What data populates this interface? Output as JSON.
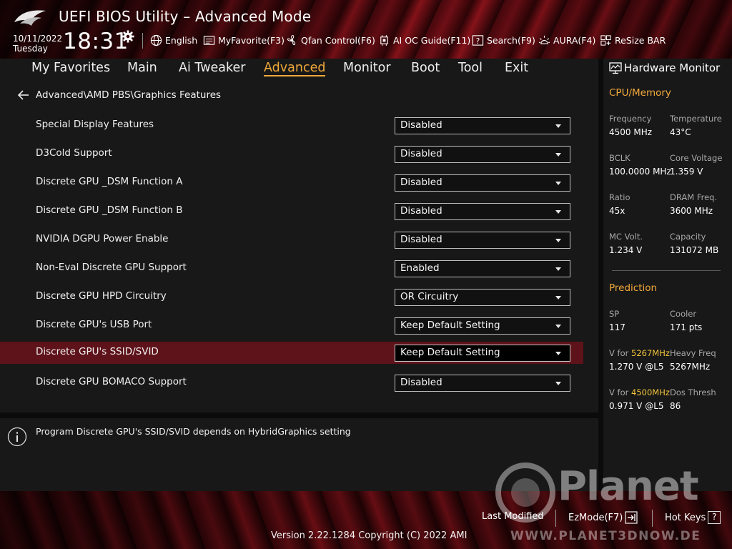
{
  "app": {
    "title": "UEFI BIOS Utility – Advanced Mode"
  },
  "header": {
    "date": "10/11/2022",
    "day": "Tuesday",
    "time": "18:31",
    "tools": {
      "language": "English",
      "myfavorite": "MyFavorite(F3)",
      "qfan": "Qfan Control(F6)",
      "oc_guide": "AI OC Guide(F11)",
      "search": "Search(F9)",
      "aura": "AURA(F4)",
      "resize_bar": "ReSize BAR"
    }
  },
  "tabs": [
    {
      "label": "My Favorites",
      "active": false
    },
    {
      "label": "Main",
      "active": false
    },
    {
      "label": "Ai Tweaker",
      "active": false
    },
    {
      "label": "Advanced",
      "active": true
    },
    {
      "label": "Monitor",
      "active": false
    },
    {
      "label": "Boot",
      "active": false
    },
    {
      "label": "Tool",
      "active": false
    },
    {
      "label": "Exit",
      "active": false
    }
  ],
  "breadcrumb": "Advanced\\AMD PBS\\Graphics Features",
  "settings": [
    {
      "label": "Special Display Features",
      "value": "Disabled"
    },
    {
      "label": "D3Cold Support",
      "value": "Disabled"
    },
    {
      "label": "Discrete GPU _DSM Function A",
      "value": "Disabled"
    },
    {
      "label": "Discrete GPU _DSM Function B",
      "value": "Disabled"
    },
    {
      "label": "NVIDIA DGPU Power Enable",
      "value": "Disabled"
    },
    {
      "label": "Non-Eval Discrete GPU Support",
      "value": "Enabled"
    },
    {
      "label": "Discrete GPU HPD Circuitry",
      "value": "OR Circuitry"
    },
    {
      "label": "Discrete GPU's USB Port",
      "value": "Keep Default Setting"
    },
    {
      "label": "Discrete GPU's SSID/SVID",
      "value": "Keep Default Setting",
      "selected": true
    },
    {
      "label": "Discrete GPU BOMACO Support",
      "value": "Disabled"
    }
  ],
  "help_text": "Program Discrete GPU's SSID/SVID depends on HybridGraphics setting",
  "hardware_monitor": {
    "title": "Hardware Monitor",
    "cpu_memory": {
      "section": "CPU/Memory",
      "frequency_label": "Frequency",
      "frequency_value": "4500 MHz",
      "temperature_label": "Temperature",
      "temperature_value": "43°C",
      "bclk_label": "BCLK",
      "bclk_value": "100.0000 MHz",
      "core_voltage_label": "Core Voltage",
      "core_voltage_value": "1.359 V",
      "ratio_label": "Ratio",
      "ratio_value": "45x",
      "dram_freq_label": "DRAM Freq.",
      "dram_freq_value": "3600 MHz",
      "mc_volt_label": "MC Volt.",
      "mc_volt_value": "1.234 V",
      "capacity_label": "Capacity",
      "capacity_value": "131072 MB"
    },
    "prediction": {
      "section": "Prediction",
      "sp_label": "SP",
      "sp_value": "117",
      "cooler_label": "Cooler",
      "cooler_value": "171 pts",
      "v_for_prefix": "V for ",
      "v_for_1_freq": "5267MHz",
      "v_for_1_value": "1.270 V @L5",
      "heavy_freq_label": "Heavy Freq",
      "heavy_freq_value": "5267MHz",
      "v_for_2_freq": "4500MHz",
      "v_for_2_value": "0.971 V @L5",
      "dos_thresh_label": "Dos Thresh",
      "dos_thresh_value": "86"
    }
  },
  "footer": {
    "last_modified": "Last Modified",
    "ezmode": "EzMode(F7)",
    "hotkeys": "Hot Keys",
    "hotkeys_key": "?",
    "version": "Version 2.22.1284 Copyright (C) 2022 AMI"
  },
  "watermark": {
    "text": "Planet",
    "url": "WWW.PLANET3DNOW.DE"
  },
  "colors": {
    "accent": "#f2a93b",
    "highlight": "#f2c43b",
    "selected_row": "#5e1219"
  }
}
